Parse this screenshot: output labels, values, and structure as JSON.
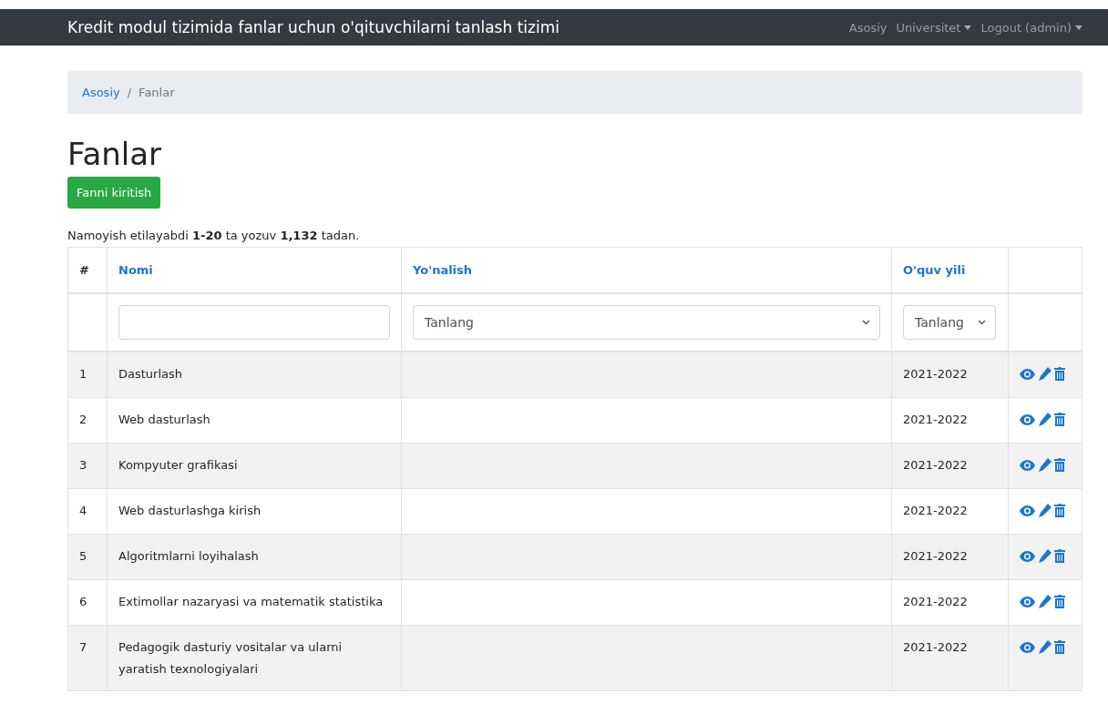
{
  "navbar": {
    "brand": "Kredit modul tizimida fanlar uchun o'qituvchilarni tanlash tizimi",
    "links": [
      {
        "label": "Asosiy",
        "dropdown": false
      },
      {
        "label": "Universitet",
        "dropdown": true
      },
      {
        "label": "Logout (admin)",
        "dropdown": true
      }
    ]
  },
  "breadcrumb": {
    "link": "Asosiy",
    "separator": "/",
    "current": "Fanlar"
  },
  "heading": "Fanlar",
  "add_button": "Fanni kiritish",
  "summary": "Namoyish etilayabdi **1-20** ta yozuv **1,132** tadan.",
  "table": {
    "columns": [
      {
        "label": "#",
        "sortable": false
      },
      {
        "label": "Nomi",
        "sortable": true
      },
      {
        "label": "Yo'nalish",
        "sortable": true
      },
      {
        "label": "O'quv yili",
        "sortable": true
      }
    ],
    "filters": {
      "yonalish_placeholder": "Tanlang",
      "oquv_yili_placeholder": "Tanlang"
    },
    "rows": [
      {
        "num": "1",
        "name": "Dasturlash",
        "year": "2021-2022"
      },
      {
        "num": "2",
        "name": "Web dasturlash",
        "year": "2021-2022"
      },
      {
        "num": "3",
        "name": "Kompyuter grafikasi",
        "year": "2021-2022"
      },
      {
        "num": "4",
        "name": "Web dasturlashga kirish",
        "year": "2021-2022"
      },
      {
        "num": "5",
        "name": "Algoritmlarni loyihalash",
        "year": "2021-2022"
      },
      {
        "num": "6",
        "name": "Extimollar nazaryasi va matematik statistika",
        "year": "2021-2022"
      },
      {
        "num": "7",
        "name": "Pedagogik dasturiy vositalar va ularni yaratish texnologiyalari",
        "year": "2021-2022"
      }
    ]
  }
}
